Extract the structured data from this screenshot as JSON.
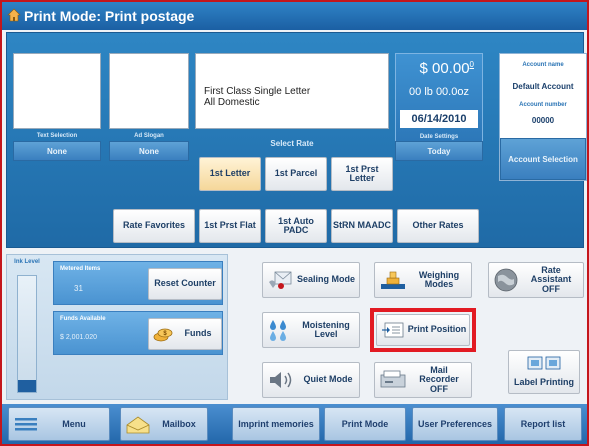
{
  "window": {
    "title": "Print Mode: Print postage"
  },
  "postage": {
    "amount_main": "$ 00.00",
    "amount_sup": "0",
    "weight": "00 lb 00.0oz",
    "date": "06/14/2010"
  },
  "rate_box": {
    "line1": "First Class Single Letter",
    "line2": "All Domestic"
  },
  "selectors": {
    "text_selection_label": "Text Selection",
    "text_selection_value": "None",
    "ad_slogan_label": "Ad Slogan",
    "ad_slogan_value": "None",
    "date_settings_label": "Date Settings",
    "date_settings_value": "Today"
  },
  "account": {
    "name_label": "Account name",
    "name_value": "Default Account",
    "number_label": "Account number",
    "number_value": "00000",
    "selection_button": "Account Selection"
  },
  "select_rate": {
    "label": "Select Rate",
    "buttons": {
      "first_letter": "1st Letter",
      "first_parcel": "1st Parcel",
      "first_prst_letter": "1st Prst Letter",
      "rate_favorites": "Rate Favorites",
      "first_prst_flat": "1st Prst Flat",
      "first_auto_padc": "1st Auto PADC",
      "strn_maadc": "StRN MAADC",
      "other_rates": "Other Rates"
    }
  },
  "left_panel": {
    "ink_level_label": "Ink Level",
    "metered_items_label": "Metered Items",
    "metered_items_value": "31",
    "reset_counter_button": "Reset Counter",
    "funds_available_label": "Funds Available",
    "funds_available_value": "$ 2,001.020",
    "funds_button": "Funds"
  },
  "modes": {
    "sealing_mode": "Sealing Mode",
    "weighing_modes": "Weighing Modes",
    "rate_assistant_line1": "Rate",
    "rate_assistant_line2": "Assistant",
    "rate_assistant_line3": "OFF",
    "moistening_level": "Moistening Level",
    "print_position": "Print Position",
    "quiet_mode": "Quiet Mode",
    "mail_recorder_line1": "Mail",
    "mail_recorder_line2": "Recorder",
    "mail_recorder_line3": "OFF",
    "label_printing": "Label Printing"
  },
  "bottom_bar": {
    "menu": "Menu",
    "mailbox": "Mailbox",
    "imprint_memories": "Imprint memories",
    "print_mode": "Print Mode",
    "user_preferences": "User Preferences",
    "report_list": "Report list"
  },
  "colors": {
    "highlight": "#e21b23",
    "title_bar": "#1b5fa3",
    "panel_blue": "#2e86c4",
    "selected_rate": "#f5d79a"
  }
}
